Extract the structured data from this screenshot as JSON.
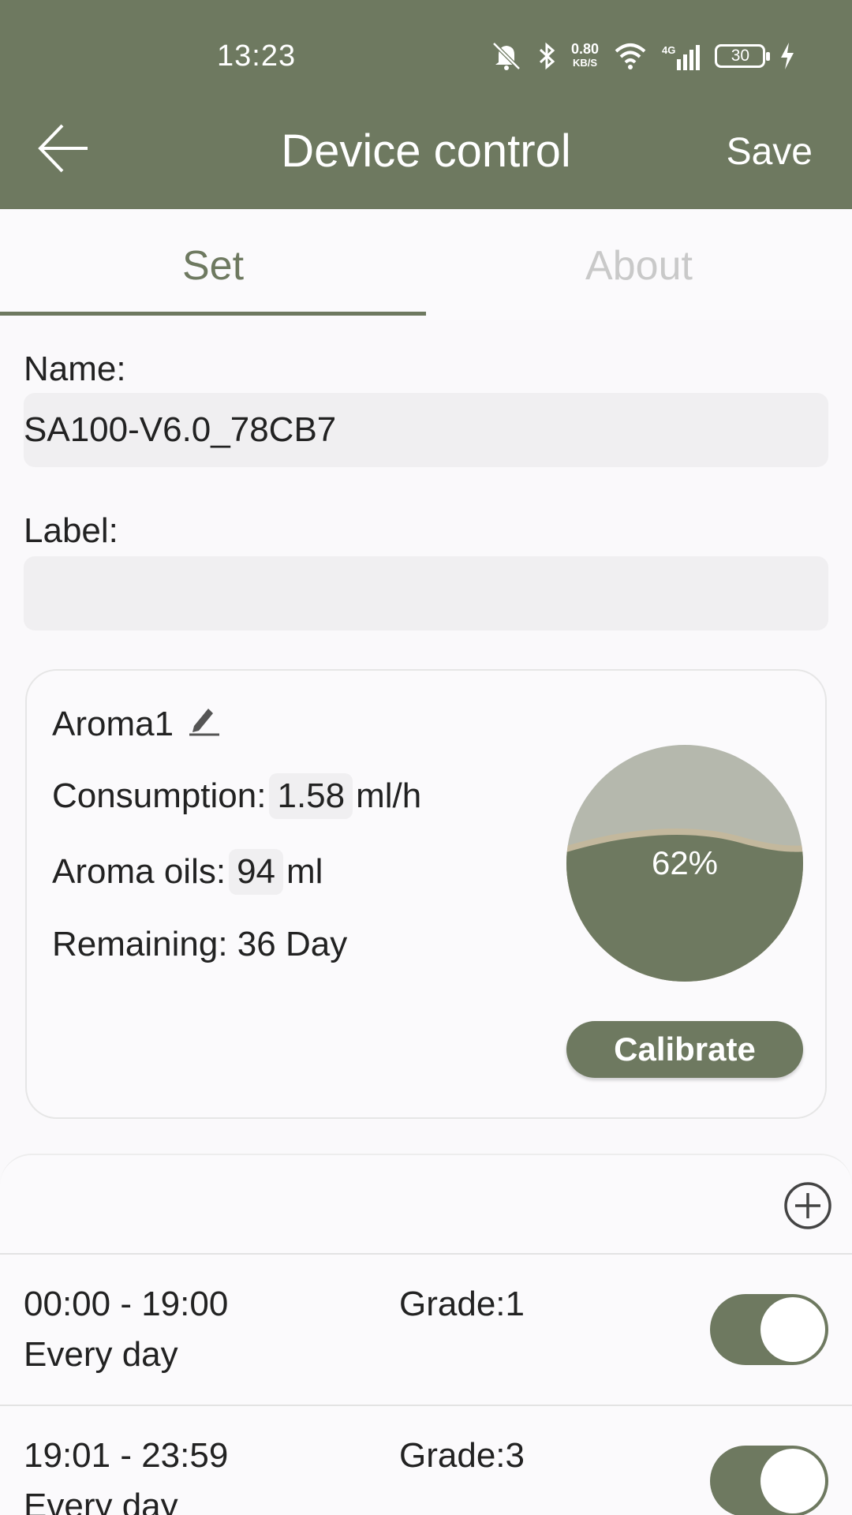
{
  "status_bar": {
    "time": "13:23",
    "net_speed_value": "0.80",
    "net_speed_unit": "KB/S",
    "network_type": "4G",
    "battery_level": "30"
  },
  "header": {
    "title": "Device control",
    "save_label": "Save"
  },
  "tabs": [
    {
      "label": "Set",
      "active": true
    },
    {
      "label": "About",
      "active": false
    }
  ],
  "form": {
    "name_label": "Name:",
    "name_value": "SA100-V6.0_78CB7",
    "label_label": "Label:",
    "label_value": ""
  },
  "aroma": {
    "title": "Aroma1",
    "consumption_label": "Consumption:",
    "consumption_value": "1.58",
    "consumption_unit": "ml/h",
    "oils_label": "Aroma oils:",
    "oils_value": "94",
    "oils_unit": "ml",
    "remaining": "Remaining: 36 Day",
    "level_percent": "62%",
    "level_fraction": 0.62,
    "calibrate_label": "Calibrate"
  },
  "schedules": [
    {
      "time": "00:00 - 19:00",
      "repeat": "Every day",
      "grade": "Grade:1",
      "enabled": true
    },
    {
      "time": "19:01 - 23:59",
      "repeat": "Every day",
      "grade": "Grade:3",
      "enabled": true
    }
  ],
  "colors": {
    "brand": "#6e7960",
    "gauge_top": "#b5b8ad",
    "gauge_wave": "#c3b89d"
  },
  "icons": {
    "back": "arrow-left-icon",
    "edit": "pencil-icon",
    "add": "plus-circle-icon"
  }
}
